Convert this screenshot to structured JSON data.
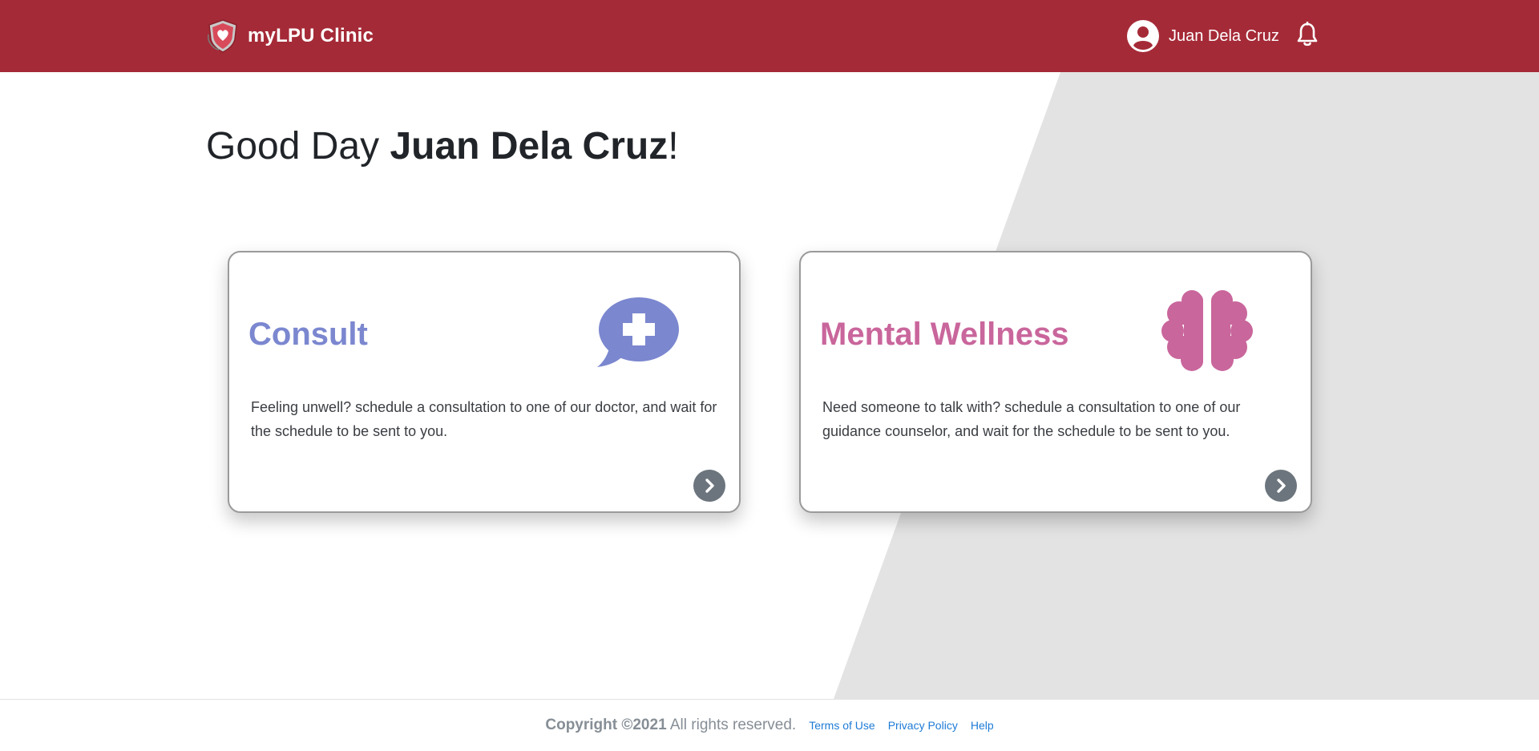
{
  "colors": {
    "brand": "#a52a37",
    "background_shape": "#e3e3e3",
    "consult_accent": "#7b87cf",
    "wellness_accent": "#c9669c",
    "arrow_button": "#6c757d",
    "link": "#1e7bd6"
  },
  "header": {
    "logo_icon": "shield-heart-logo",
    "app_name": "myLPU Clinic",
    "user": {
      "avatar_icon": "user-circle-icon",
      "name": "Juan Dela Cruz"
    },
    "notification_icon": "bell-icon"
  },
  "greeting": {
    "prefix": "Good Day ",
    "name": "Juan Dela Cruz",
    "suffix": "!"
  },
  "cards": [
    {
      "title": "Consult",
      "icon": "speech-bubble-plus-icon",
      "description": "Feeling unwell? schedule a consultation to one of our doctor, and wait for the schedule to be sent to you.",
      "action_icon": "chevron-right-icon"
    },
    {
      "title": "Mental Wellness",
      "icon": "brain-icon",
      "description": "Need someone to talk with? schedule a consultation to one of our guidance counselor, and wait for the schedule to be sent to you.",
      "action_icon": "chevron-right-icon"
    }
  ],
  "footer": {
    "copyright_bold": "Copyright ©2021",
    "copyright_rest": " All rights reserved.",
    "links": [
      "Terms of Use",
      "Privacy Policy",
      "Help"
    ]
  }
}
